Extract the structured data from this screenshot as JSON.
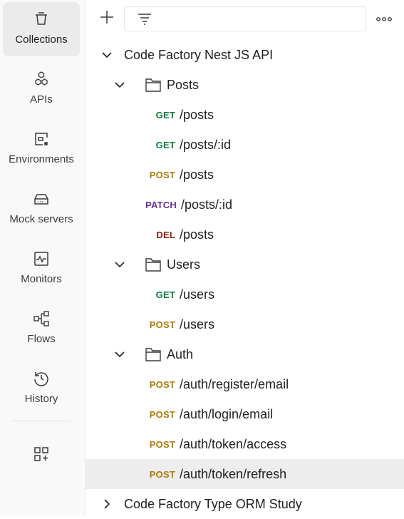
{
  "sidebar": {
    "items": [
      {
        "label": "Collections",
        "icon": "collections-icon"
      },
      {
        "label": "APIs",
        "icon": "apis-icon"
      },
      {
        "label": "Environments",
        "icon": "environments-icon"
      },
      {
        "label": "Mock servers",
        "icon": "mock-servers-icon"
      },
      {
        "label": "Monitors",
        "icon": "monitors-icon"
      },
      {
        "label": "Flows",
        "icon": "flows-icon"
      },
      {
        "label": "History",
        "icon": "history-icon"
      }
    ]
  },
  "search": {
    "value": "",
    "placeholder": ""
  },
  "tree": {
    "collection1": "Code Factory Nest JS API",
    "folder_posts": "Posts",
    "folder_users": "Users",
    "folder_auth": "Auth",
    "collection2": "Code Factory Type ORM Study",
    "requests": [
      {
        "method": "GET",
        "path": "/posts"
      },
      {
        "method": "GET",
        "path": "/posts/:id"
      },
      {
        "method": "POST",
        "path": "/posts"
      },
      {
        "method": "PATCH",
        "path": "/posts/:id"
      },
      {
        "method": "DEL",
        "path": "/posts"
      },
      {
        "method": "GET",
        "path": "/users"
      },
      {
        "method": "POST",
        "path": "/users"
      },
      {
        "method": "POST",
        "path": "/auth/register/email"
      },
      {
        "method": "POST",
        "path": "/auth/login/email"
      },
      {
        "method": "POST",
        "path": "/auth/token/access"
      },
      {
        "method": "POST",
        "path": "/auth/token/refresh"
      }
    ]
  },
  "colors": {
    "get": "#0b7a3e",
    "post": "#ad7a03",
    "patch": "#623497",
    "del": "#8e1a10",
    "selected_row": "#ededed",
    "sidebar_bg": "#f9f9f9"
  }
}
